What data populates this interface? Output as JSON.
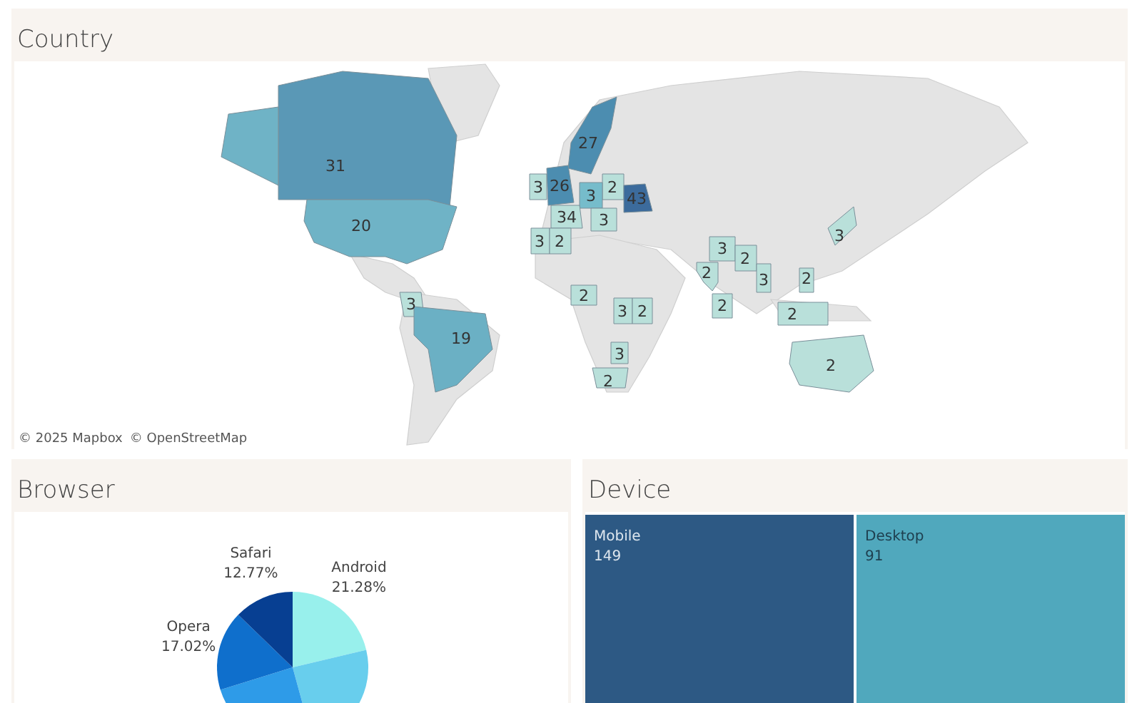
{
  "country": {
    "title": "Country",
    "map": {
      "labels": [
        {
          "text": "31",
          "color": "#5a98b6"
        },
        {
          "text": "20",
          "color": "#6fb3c6"
        },
        {
          "text": "27",
          "color": "#4c8db0"
        },
        {
          "text": "3",
          "color": "#b9e0da"
        },
        {
          "text": "26",
          "color": "#4c8db0"
        },
        {
          "text": "2",
          "color": "#b9e0da"
        },
        {
          "text": "3",
          "color": "#76bccb"
        },
        {
          "text": "43",
          "color": "#3c6b9c"
        },
        {
          "text": "34",
          "color": "#b9e0da"
        },
        {
          "text": "3",
          "color": "#b9e0da"
        },
        {
          "text": "3",
          "color": "#b9e0da"
        },
        {
          "text": "2",
          "color": "#b9e0da"
        },
        {
          "text": "2",
          "color": "#b9e0da"
        },
        {
          "text": "3",
          "color": "#b9e0da"
        },
        {
          "text": "19",
          "color": "#6bb0c4"
        },
        {
          "text": "3",
          "color": "#b9e0da"
        },
        {
          "text": "2",
          "color": "#b9e0da"
        },
        {
          "text": "2",
          "color": "#b9e0da"
        },
        {
          "text": "3",
          "color": "#b9e0da"
        },
        {
          "text": "2",
          "color": "#b9e0da"
        },
        {
          "text": "2",
          "color": "#b9e0da"
        },
        {
          "text": "3",
          "color": "#b9e0da"
        },
        {
          "text": "2",
          "color": "#b9e0da"
        },
        {
          "text": "2",
          "color": "#b9e0da"
        },
        {
          "text": "3",
          "color": "#b9e0da"
        },
        {
          "text": "3",
          "color": "#b9e0da"
        },
        {
          "text": "2",
          "color": "#b9e0da"
        },
        {
          "text": "2",
          "color": "#b9e0da"
        }
      ],
      "attribution": [
        "© 2025 Mapbox",
        "© OpenStreetMap"
      ]
    }
  },
  "browser": {
    "title": "Browser",
    "slices": [
      {
        "label": "Android",
        "percent": "21.28%",
        "color": "#98f0ec"
      },
      {
        "color": "#68ceed"
      },
      {
        "color": "#2e9be8"
      },
      {
        "label": "Opera",
        "percent": "17.02%",
        "color": "#0f6fcc"
      },
      {
        "label": "Safari",
        "percent": "12.77%",
        "color": "#073f92"
      }
    ]
  },
  "device": {
    "title": "Device",
    "tiles": [
      {
        "label": "Mobile",
        "value": "149",
        "color": "#2d5984"
      },
      {
        "label": "Desktop",
        "value": "91",
        "color": "#50a8bd"
      }
    ]
  }
}
